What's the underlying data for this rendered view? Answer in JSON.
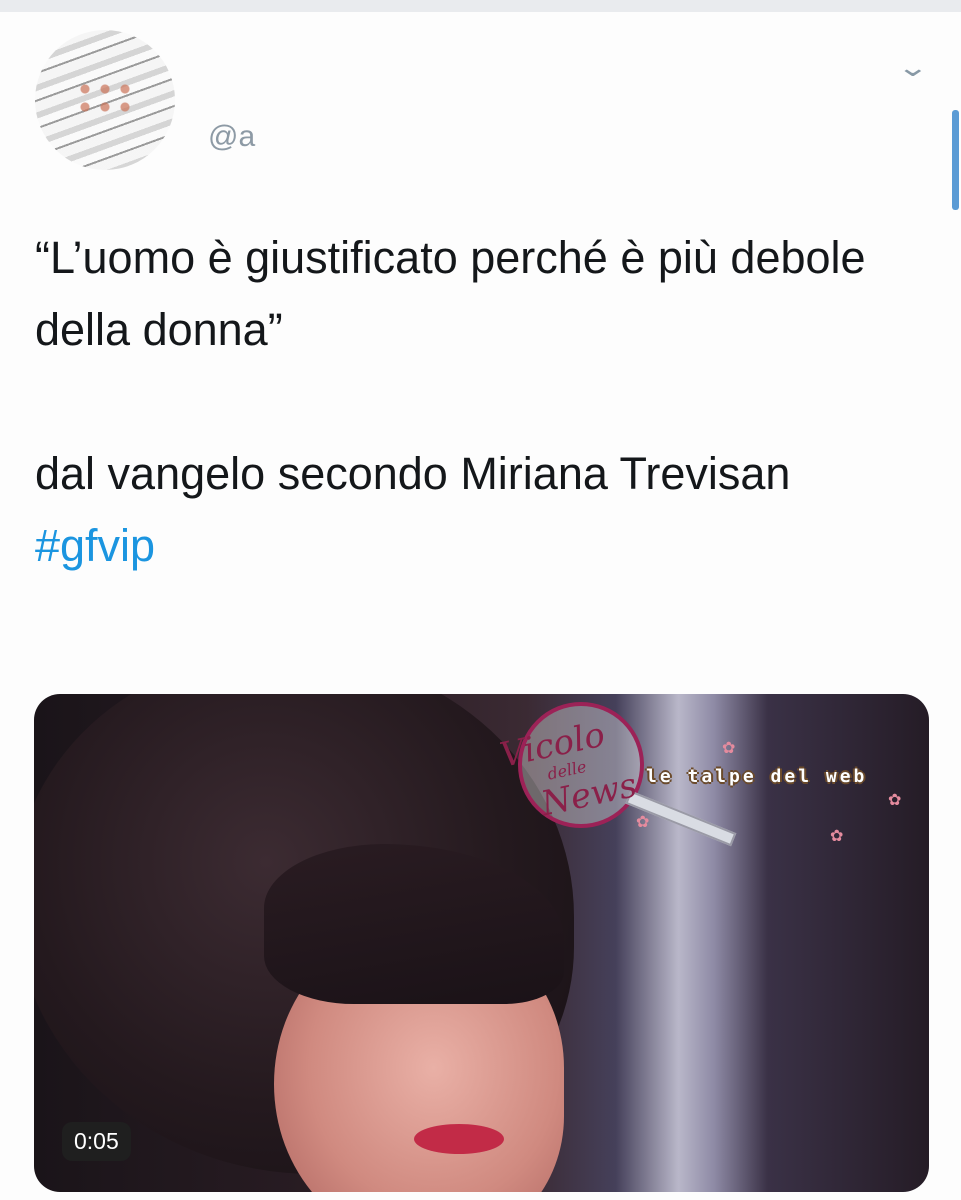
{
  "account": {
    "display_name": "",
    "handle": "@a"
  },
  "tweet": {
    "line1": "“L’uomo è giustificato perché è più debole della donna”",
    "line2": "dal vangelo secondo Miriana Trevisan",
    "hashtag": "#gfvip"
  },
  "media": {
    "duration": "0:05",
    "watermark_1_line1": "Vicolo",
    "watermark_1_line2": "delle",
    "watermark_1_line3": "News",
    "watermark_2": "le talpe del web"
  },
  "colors": {
    "hashtag": "#1b95e0",
    "text": "#14171a",
    "handle": "#8d9aa5"
  },
  "icons": {
    "menu": "chevron-down-icon",
    "avatar": "avatar"
  }
}
